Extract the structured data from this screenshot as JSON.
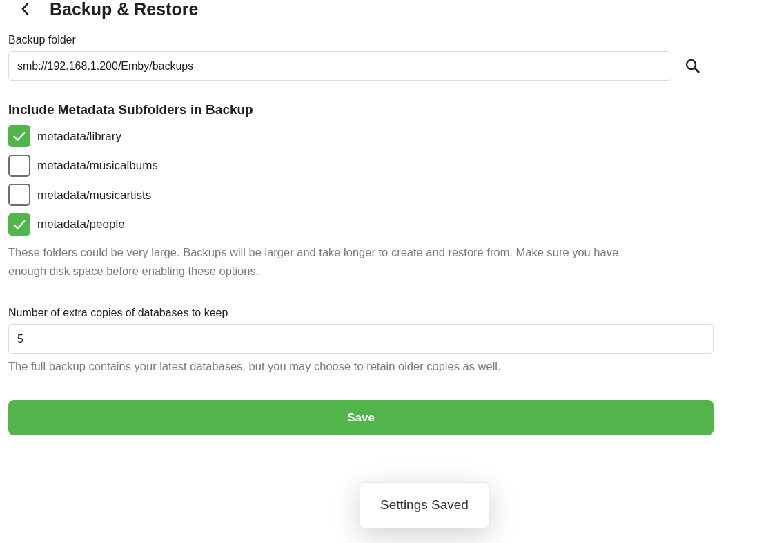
{
  "page": {
    "title": "Backup & Restore"
  },
  "backup_folder": {
    "label": "Backup folder",
    "value": "smb://192.168.1.200/Emby/backups"
  },
  "metadata": {
    "heading": "Include Metadata Subfolders in Backup",
    "options": [
      {
        "label": "metadata/library",
        "checked": true
      },
      {
        "label": "metadata/musicalbums",
        "checked": false
      },
      {
        "label": "metadata/musicartists",
        "checked": false
      },
      {
        "label": "metadata/people",
        "checked": true
      }
    ],
    "help": "These folders could be very large. Backups will be larger and take longer to create and restore from. Make sure you have enough disk space before enabling these options."
  },
  "copies": {
    "label": "Number of extra copies of databases to keep",
    "value": "5",
    "help": "The full backup contains your latest databases, but you may choose to retain older copies as well."
  },
  "save_button": "Save",
  "toast": "Settings Saved"
}
